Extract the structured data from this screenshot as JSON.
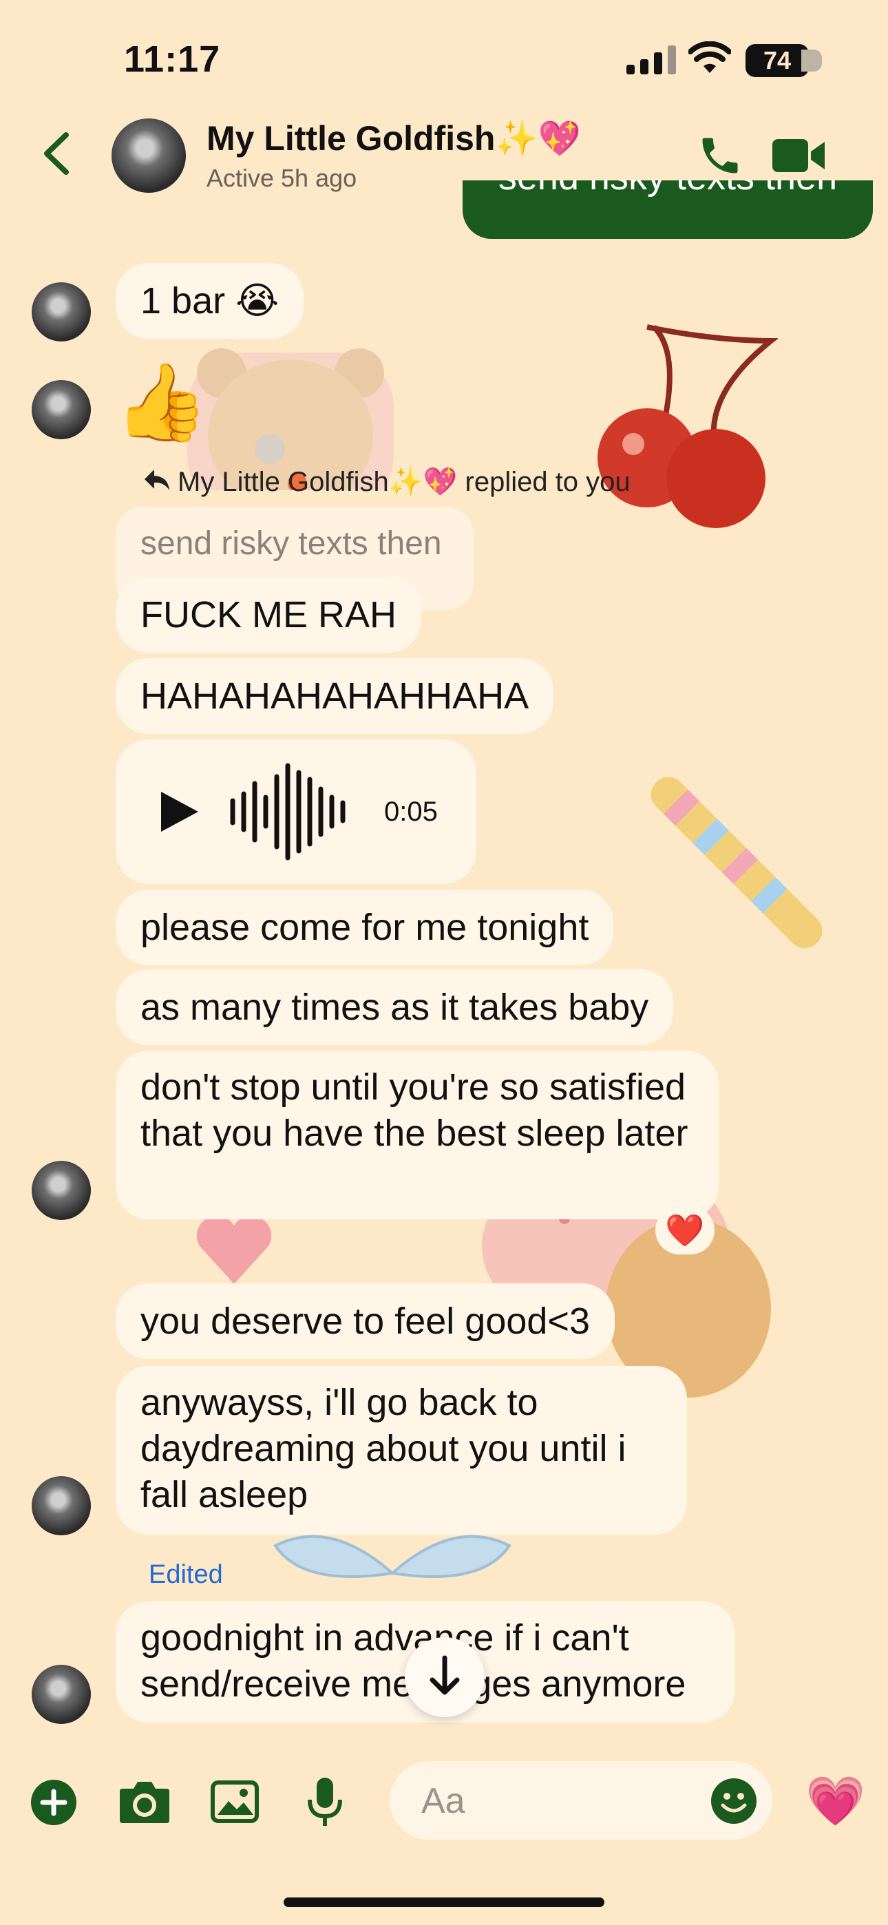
{
  "status_bar": {
    "time": "11:17",
    "battery": "74"
  },
  "header": {
    "contact_name": "My Little Goldfish✨💖",
    "status": "Active 5h ago"
  },
  "messages": {
    "sent_partial": "send risky texts then",
    "m1": "1 bar 😭",
    "m2_emoji": "👍",
    "reply_label": "My Little Goldfish✨💖 replied to you",
    "quoted": "send risky texts then",
    "m3": "FUCK ME RAH",
    "m4": "HAHAHAHAHAHHAHA",
    "voice_duration": "0:05",
    "m5": "please come for me tonight",
    "m6": "as many times as it takes baby",
    "m7": "don't stop until you're so satisfied that you have the best sleep later",
    "reaction": "❤️",
    "m8": "you deserve to feel good<3",
    "m9": "anywayss, i'll go back to daydreaming about you until i fall asleep",
    "edited_label": "Edited",
    "m10": "goodnight in advance if i can't send/receive messages anymore"
  },
  "composer": {
    "placeholder": "Aa",
    "like_emoji": "💗"
  },
  "colors": {
    "accent": "#1a5a1e",
    "background": "#fde8c8",
    "bubble": "#fff6e8"
  }
}
